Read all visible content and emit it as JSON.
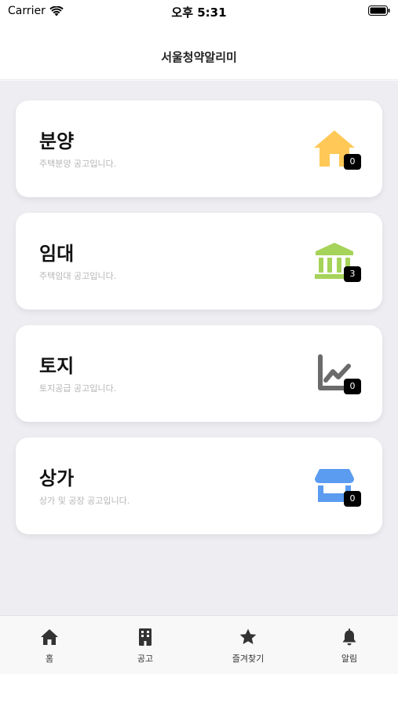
{
  "status_bar": {
    "carrier": "Carrier",
    "time": "오후 5:31"
  },
  "header": {
    "title": "서울청약알리미"
  },
  "cards": [
    {
      "title": "분양",
      "subtitle": "주택분양 공고입니다.",
      "badge": "0",
      "icon": "house-icon",
      "color": "#FFC857"
    },
    {
      "title": "임대",
      "subtitle": "주택임대 공고입니다.",
      "badge": "3",
      "icon": "bank-icon",
      "color": "#A6D35A"
    },
    {
      "title": "토지",
      "subtitle": "토지공급 공고입니다.",
      "badge": "0",
      "icon": "chart-line-icon",
      "color": "#6B6B6B"
    },
    {
      "title": "상가",
      "subtitle": "상가 및 공장 공고입니다.",
      "badge": "0",
      "icon": "store-icon",
      "color": "#5B9BF0"
    }
  ],
  "tabs": [
    {
      "label": "홈",
      "icon": "home-icon"
    },
    {
      "label": "공고",
      "icon": "building-icon"
    },
    {
      "label": "즐겨찾기",
      "icon": "star-icon"
    },
    {
      "label": "알림",
      "icon": "bell-icon"
    }
  ],
  "colors": {
    "tab_icon": "#333333",
    "background": "#EEEEF2"
  }
}
